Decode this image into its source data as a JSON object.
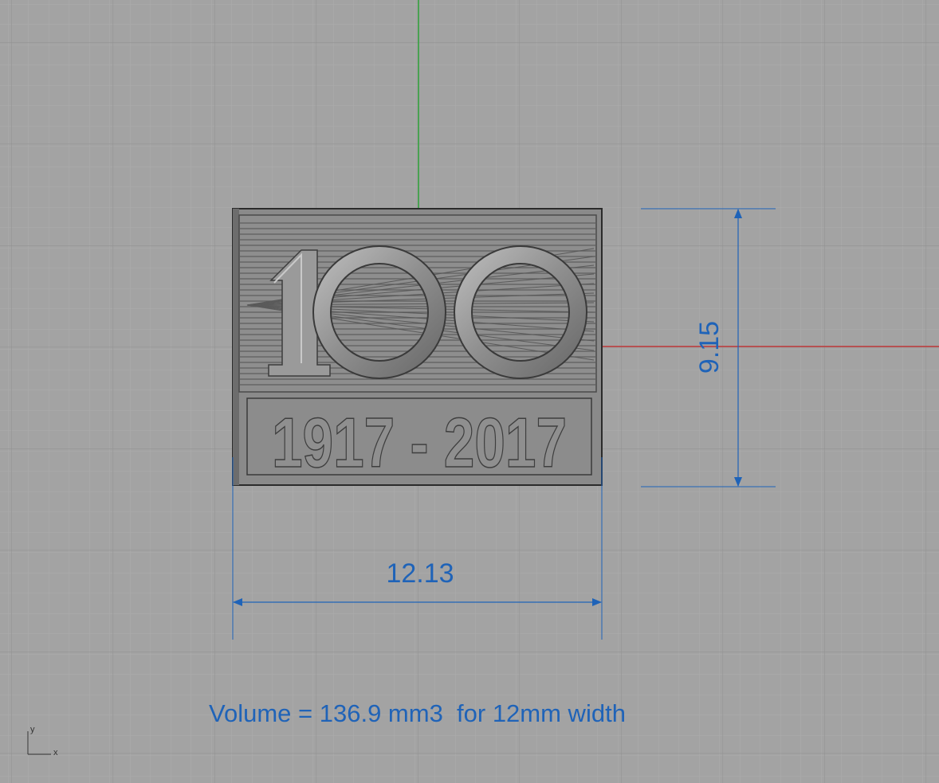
{
  "viewport": {
    "background": "#a3a3a3",
    "grid_minor_color": "#adadad",
    "grid_major_color": "#939393",
    "x_axis_color": "#c0393b",
    "y_axis_color": "#2fa33a"
  },
  "model": {
    "big_number": "100",
    "years": "1917 - 2017",
    "surface_color": "#8a8a8a"
  },
  "dimensions": {
    "width": "12.13",
    "height": "9.15",
    "color": "#1f63b8"
  },
  "annotation": {
    "volume_note": "Volume = 136.9 mm3  for 12mm width"
  },
  "axis_widget": {
    "y_label": "y",
    "x_label": "x"
  }
}
